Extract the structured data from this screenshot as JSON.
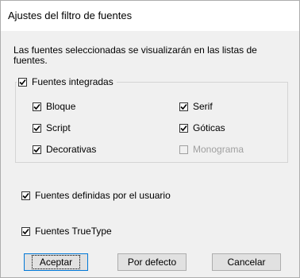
{
  "dialog": {
    "title": "Ajustes del filtro de fuentes",
    "description": "Las fuentes seleccionadas se visualizarán en las listas de fuentes."
  },
  "group": {
    "label": "Fuentes integradas",
    "checked": true,
    "items": [
      {
        "label": "Bloque",
        "checked": true,
        "enabled": true
      },
      {
        "label": "Serif",
        "checked": true,
        "enabled": true
      },
      {
        "label": "Script",
        "checked": true,
        "enabled": true
      },
      {
        "label": "Góticas",
        "checked": true,
        "enabled": true
      },
      {
        "label": "Decorativas",
        "checked": true,
        "enabled": true
      },
      {
        "label": "Monograma",
        "checked": false,
        "enabled": false
      }
    ]
  },
  "options": {
    "user_fonts": {
      "label": "Fuentes definidas por el usuario",
      "checked": true
    },
    "truetype_fonts": {
      "label": "Fuentes TrueType",
      "checked": true
    }
  },
  "buttons": {
    "accept": "Aceptar",
    "default": "Por defecto",
    "cancel": "Cancelar"
  }
}
